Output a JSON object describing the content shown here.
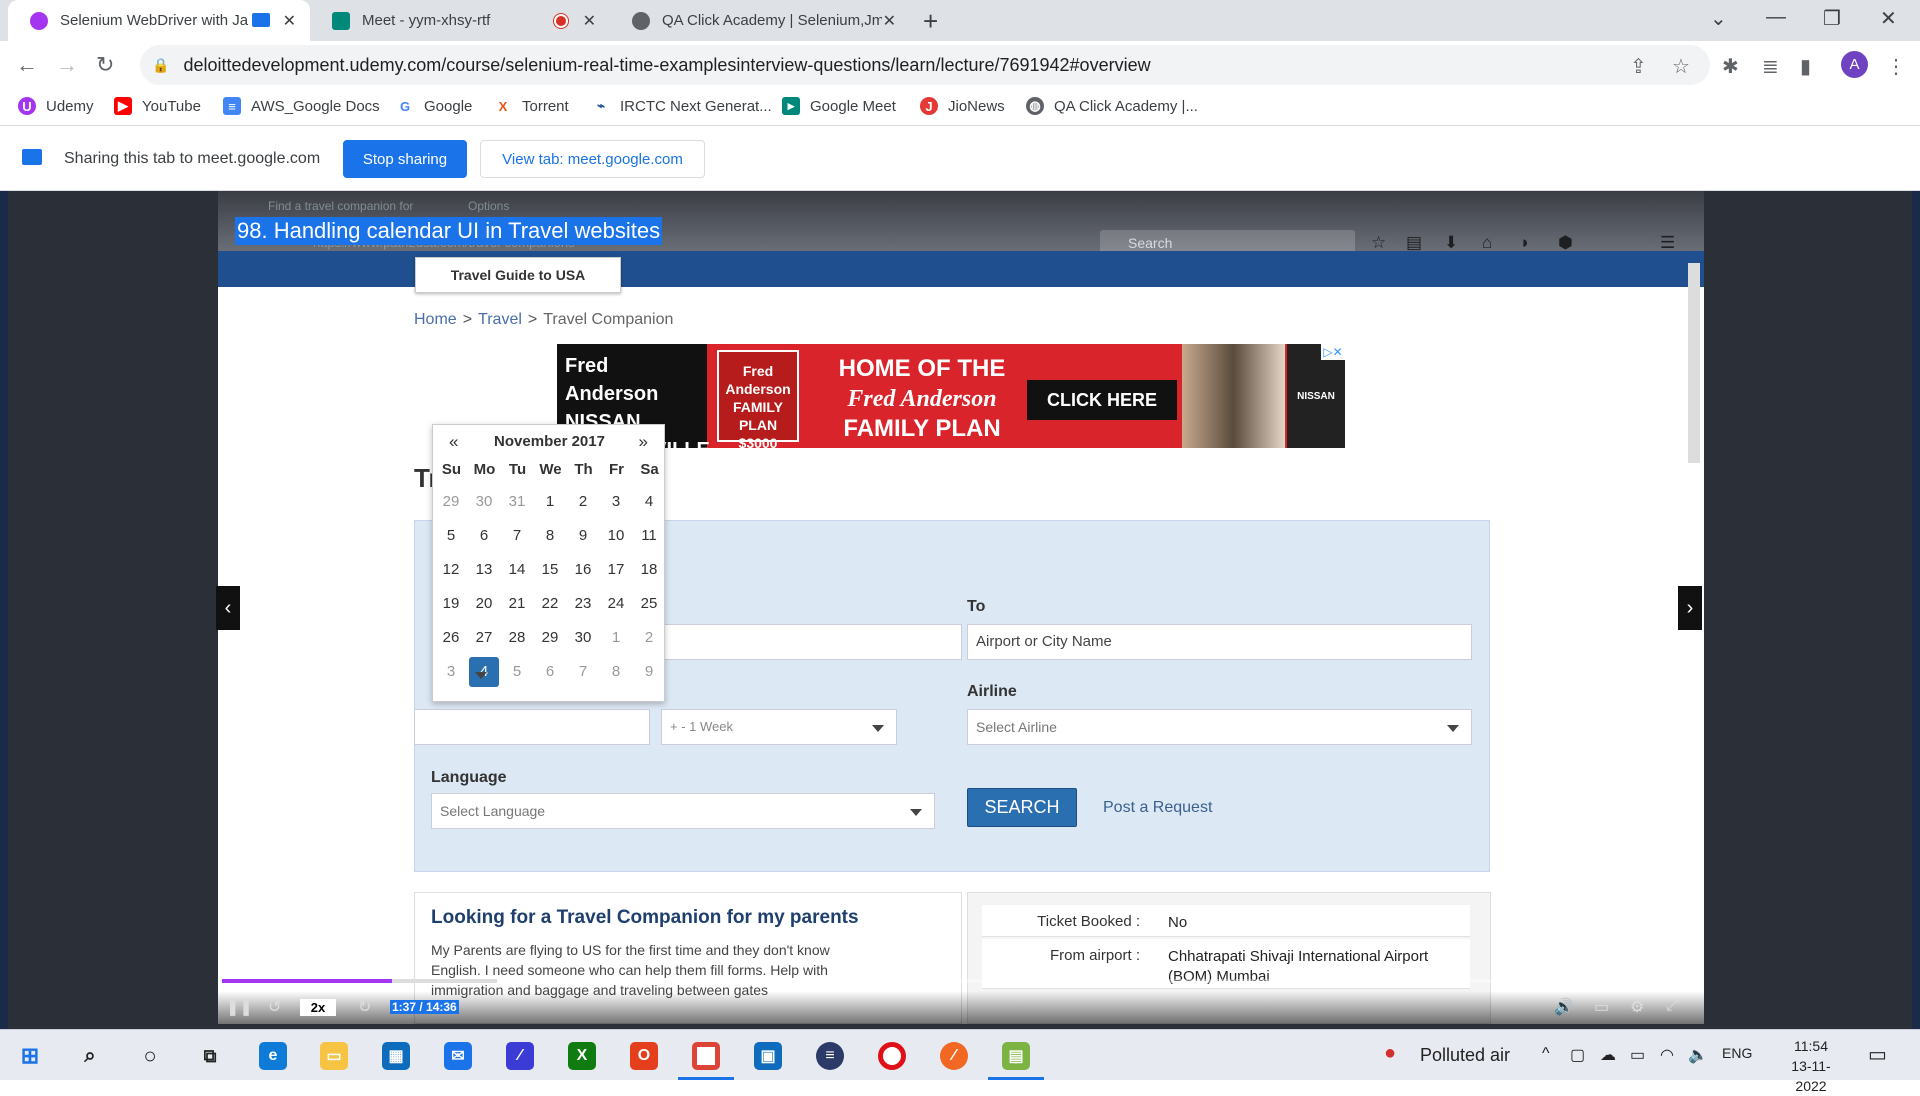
{
  "browser": {
    "tabs": [
      {
        "title": "Selenium WebDriver with Ja",
        "favicon_color": "#a435f0",
        "active": true
      },
      {
        "title": "Meet - yym-xhsy-rtf",
        "favicon_color": "#00897b",
        "active": false
      },
      {
        "title": "QA Click Academy | Selenium,Jm",
        "favicon_color": "#5f6368",
        "active": false
      }
    ],
    "url": "deloittedevelopment.udemy.com/course/selenium-real-time-examplesinterview-questions/learn/lecture/7691942#overview",
    "profile_initial": "A",
    "bookmarks": [
      {
        "label": "Udemy",
        "icon_color": "#a435f0",
        "glyph": "U"
      },
      {
        "label": "YouTube",
        "icon_color": "#ff0000",
        "glyph": "▶"
      },
      {
        "label": "AWS_Google Docs",
        "icon_color": "#4285f4",
        "glyph": "≡"
      },
      {
        "label": "Google",
        "icon_color": "#ffffff",
        "glyph": "G"
      },
      {
        "label": "Torrent",
        "icon_color": "#ffffff",
        "glyph": "X"
      },
      {
        "label": "IRCTC Next Generat...",
        "icon_color": "#ffffff",
        "glyph": "⌁"
      },
      {
        "label": "Google Meet",
        "icon_color": "#00897b",
        "glyph": "▸"
      },
      {
        "label": "JioNews",
        "icon_color": "#e53935",
        "glyph": "J"
      },
      {
        "label": "QA Click Academy |...",
        "icon_color": "#5f6368",
        "glyph": "◍"
      }
    ]
  },
  "share_bar": {
    "message": "Sharing this tab to meet.google.com",
    "stop_label": "Stop sharing",
    "view_label": "View tab: meet.google.com"
  },
  "video": {
    "lecture_title": "98. Handling calendar UI in Travel websites",
    "inner_tabs": [
      "Find a travel companion for",
      "Options"
    ],
    "inner_url": "https://www.path2usa.com/travel-companions",
    "inner_search_placeholder": "Search",
    "travel_guide": "Travel Guide to USA",
    "breadcrumb": [
      "Home",
      "Travel",
      "Travel Companion"
    ],
    "ad": {
      "brand": "Fred Anderson NISSAN FAYETTEVILLE",
      "badge": "Fred Anderson FAMILY PLAN $3000",
      "headline_1": "HOME OF THE",
      "headline_2": "Fred Anderson",
      "headline_3": "FAMILY PLAN",
      "cta": "CLICK HERE",
      "logo": "NISSAN"
    },
    "heading_partial": "Tr",
    "form": {
      "to_label": "To",
      "to_placeholder": "Airport or City Name",
      "airline_label": "Airline",
      "airline_placeholder": "Select Airline",
      "range_value": "+ - 1 Week",
      "language_label": "Language",
      "language_placeholder": "Select Language",
      "search_label": "SEARCH",
      "post_label": "Post a Request"
    },
    "calendar": {
      "month": "November 2017",
      "prev": "«",
      "next": "»",
      "dow": [
        "Su",
        "Mo",
        "Tu",
        "We",
        "Th",
        "Fr",
        "Sa"
      ],
      "weeks": [
        [
          "29",
          "30",
          "31",
          "1",
          "2",
          "3",
          "4"
        ],
        [
          "5",
          "6",
          "7",
          "8",
          "9",
          "10",
          "11"
        ],
        [
          "12",
          "13",
          "14",
          "15",
          "16",
          "17",
          "18"
        ],
        [
          "19",
          "20",
          "21",
          "22",
          "23",
          "24",
          "25"
        ],
        [
          "26",
          "27",
          "28",
          "29",
          "30",
          "1",
          "2"
        ],
        [
          "3",
          "4",
          "5",
          "6",
          "7",
          "8",
          "9"
        ]
      ],
      "selected": "4"
    },
    "post": {
      "title": "Looking for a Travel Companion for my parents",
      "body": "My Parents are flying to US for the first time and they don't know English. I need someone who can help them fill forms. Help with immigration and baggage and traveling between gates"
    },
    "details": [
      {
        "key": "Ticket Booked :",
        "value": "No"
      },
      {
        "key": "From airport :",
        "value": "Chhatrapati Shivaji International Airport (BOM) Mumbai"
      }
    ],
    "player": {
      "speed": "2x",
      "time": "1:37 / 14:36",
      "progress_fraction": 0.1105
    }
  },
  "taskbar": {
    "weather": "Polluted air",
    "language": "ENG",
    "time": "11:54",
    "date": "13-11-2022"
  }
}
